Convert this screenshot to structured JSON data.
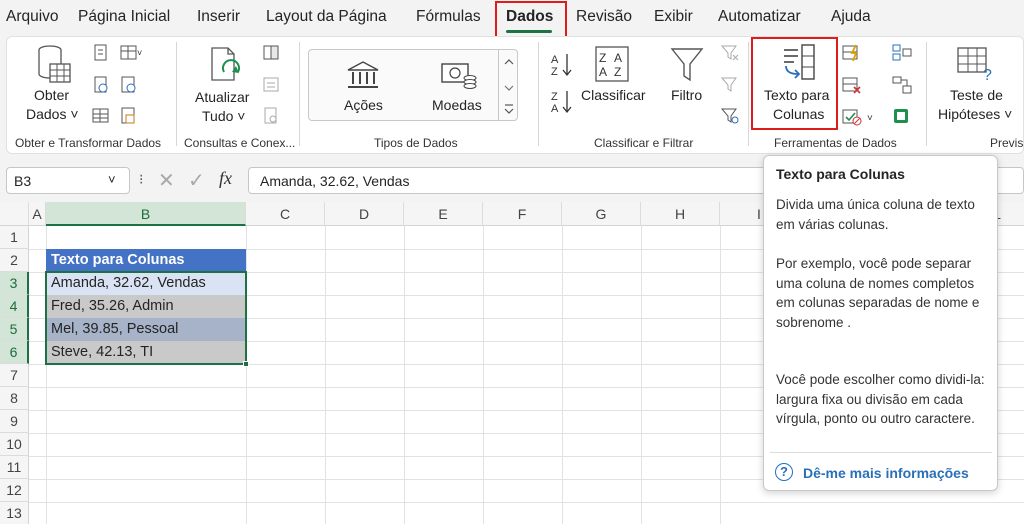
{
  "menu": {
    "tabs": [
      "Arquivo",
      "Página Inicial",
      "Inserir",
      "Layout da Página",
      "Fórmulas",
      "Dados",
      "Revisão",
      "Exibir",
      "Automatizar",
      "Ajuda"
    ],
    "active": "Dados"
  },
  "ribbon": {
    "obter_dados": {
      "line1": "Obter",
      "line2": "Dados ˅",
      "group": "Obter e Transformar Dados"
    },
    "atualizar": {
      "line1": "Atualizar",
      "line2": "Tudo ˅",
      "group": "Consultas e Conex..."
    },
    "tipos": {
      "acoes": "Ações",
      "moedas": "Moedas",
      "group": "Tipos de Dados"
    },
    "classificar": {
      "label": "Classificar",
      "filtro": "Filtro",
      "group": "Classificar e Filtrar"
    },
    "texto_colunas": {
      "line1": "Texto para",
      "line2": "Colunas"
    },
    "ferramentas": {
      "group": "Ferramentas de Dados"
    },
    "teste": {
      "line1": "Teste de",
      "line2": "Hipóteses ˅",
      "group": "Previs"
    }
  },
  "formula_bar": {
    "namebox": "B3",
    "fx": "fx",
    "value": "Amanda, 32.62, Vendas"
  },
  "grid": {
    "columns": [
      "A",
      "B",
      "C",
      "D",
      "E",
      "F",
      "G",
      "H",
      "I",
      "L"
    ],
    "rows": [
      "1",
      "2",
      "3",
      "4",
      "5",
      "6",
      "7",
      "8",
      "9",
      "10",
      "11",
      "12",
      "13"
    ],
    "cells": {
      "b2": "Texto  para Colunas",
      "b3": "Amanda, 32.62, Vendas",
      "b4": "Fred, 35.26, Admin",
      "b5": "Mel, 39.85, Pessoal",
      "b6": "Steve, 42.13, TI"
    }
  },
  "tooltip": {
    "title": "Texto para Colunas",
    "p1": "Divida uma única coluna de texto em várias colunas.",
    "p2": "Por exemplo, você pode separar uma coluna de nomes completos em colunas separadas de nome e sobrenome .",
    "p3": "Você pode escolher como dividi-la: largura fixa ou divisão em cada vírgula, ponto ou outro caractere.",
    "link": "Dê-me mais informações"
  },
  "colors": {
    "accent": "#1e7145",
    "highlight": "#e01b1b",
    "header_blue": "#4472c4",
    "link": "#2a6fb8"
  }
}
